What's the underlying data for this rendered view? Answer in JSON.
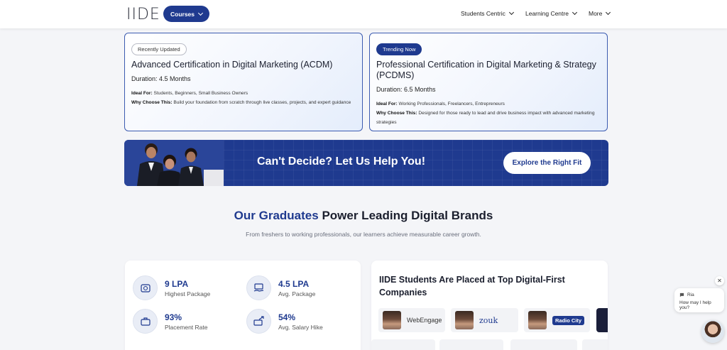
{
  "header": {
    "logo": "IIDE",
    "courses_label": "Courses",
    "nav": [
      "Students Centric",
      "Learning Centre",
      "More"
    ]
  },
  "cards": [
    {
      "tag": "Recently Updated",
      "title": "Advanced Certification in Digital Marketing (ACDM)",
      "duration": "Duration: 4.5 Months",
      "ideal_label": "Ideal For:",
      "ideal": "Students, Beginners, Small Business Owners",
      "why_label": "Why Choose This:",
      "why": "Build your foundation from scratch through live classes, projects, and expert guidance"
    },
    {
      "tag": "Trending Now",
      "title": "Professional Certification in Digital Marketing & Strategy (PCDMS)",
      "duration": "Duration: 6.5 Months",
      "ideal_label": "Ideal For:",
      "ideal": "Working Professionals, Freelancers, Entrepreneurs",
      "why_label": "Why Choose This:",
      "why": "Designed for those ready to lead and drive business impact with advanced marketing strategies"
    }
  ],
  "banner": {
    "title": "Can't Decide? Let Us Help You!",
    "button": "Explore the Right Fit"
  },
  "graduates": {
    "title_highlight": "Our Graduates",
    "title_rest": " Power Leading Digital Brands",
    "subtitle": "From freshers to working professionals, our learners achieve measurable career growth."
  },
  "stats": [
    {
      "value": "9 LPA",
      "label": "Highest Package",
      "icon": "money-bag-icon"
    },
    {
      "value": "4.5 LPA",
      "label": "Avg. Package",
      "icon": "cash-hand-icon"
    },
    {
      "value": "93%",
      "label": "Placement Rate",
      "icon": "briefcase-icon"
    },
    {
      "value": "54%",
      "label": "Avg. Salary Hike",
      "icon": "salary-growth-icon"
    }
  ],
  "placements": {
    "title": "IIDE Students Are Placed at Top Digital-First Companies",
    "brands": [
      "WebEngage",
      "zouk",
      "Radio City"
    ]
  },
  "chat": {
    "name": "Ria",
    "message": "How may I help you?",
    "close": "✕"
  },
  "colors": {
    "brand": "#1f3a8f",
    "background": "#f4f5f8"
  }
}
